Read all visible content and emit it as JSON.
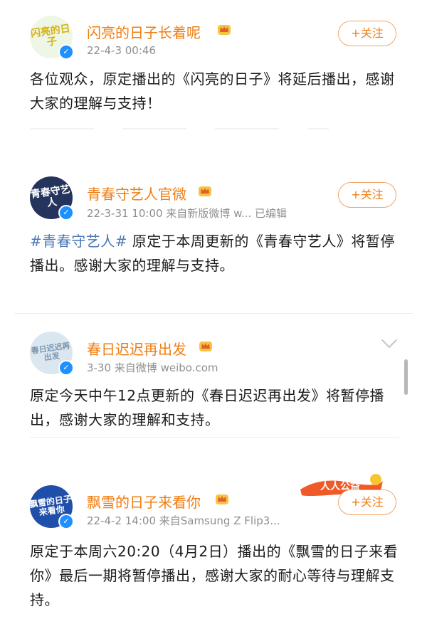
{
  "posts": [
    {
      "name": "闪亮的日子长着呢",
      "avatar_text": "闪亮的日子",
      "meta": "22-4-3 00:46",
      "follow_label": "+关注",
      "content_parts": [
        "",
        "各位观众，原定播出的《闪亮的日子》将延后播出，感谢大家的理解与支持！"
      ]
    },
    {
      "name": "青春守艺人官微",
      "avatar_text": "青春守艺人",
      "meta": "22-3-31 10:00  来自新版微博 w...  已编辑",
      "follow_label": "+关注",
      "content_parts": [
        "#青春守艺人#",
        " 原定于本周更新的《青春守艺人》将暂停播出。感谢大家的理解与支持。"
      ]
    },
    {
      "name": "春日迟迟再出发",
      "avatar_text": "春日迟迟再出发",
      "meta": "3-30  来自微博 weibo.com",
      "content_parts": [
        "",
        "原定今天中午12点更新的《春日迟迟再出发》将暂停播出，感谢大家的理解和支持。"
      ]
    },
    {
      "name": "飘雪的日子来看你",
      "avatar_text": "飘雪的日子来看你",
      "meta": "22-4-2 14:00  来自Samsung Z Flip3...",
      "follow_label": "+关注",
      "content_parts": [
        "",
        "原定于本周六20:20（4月2日）播出的《飘雪的日子来看你》最后一期将暂停播出，感谢大家的耐心等待与理解支持。"
      ]
    }
  ],
  "sticker_text": "人人公益",
  "colors": {
    "name": "#f07d11",
    "hashtag": "#4b77b5",
    "meta": "#8f8f8f",
    "verified": "#1e90ff"
  }
}
